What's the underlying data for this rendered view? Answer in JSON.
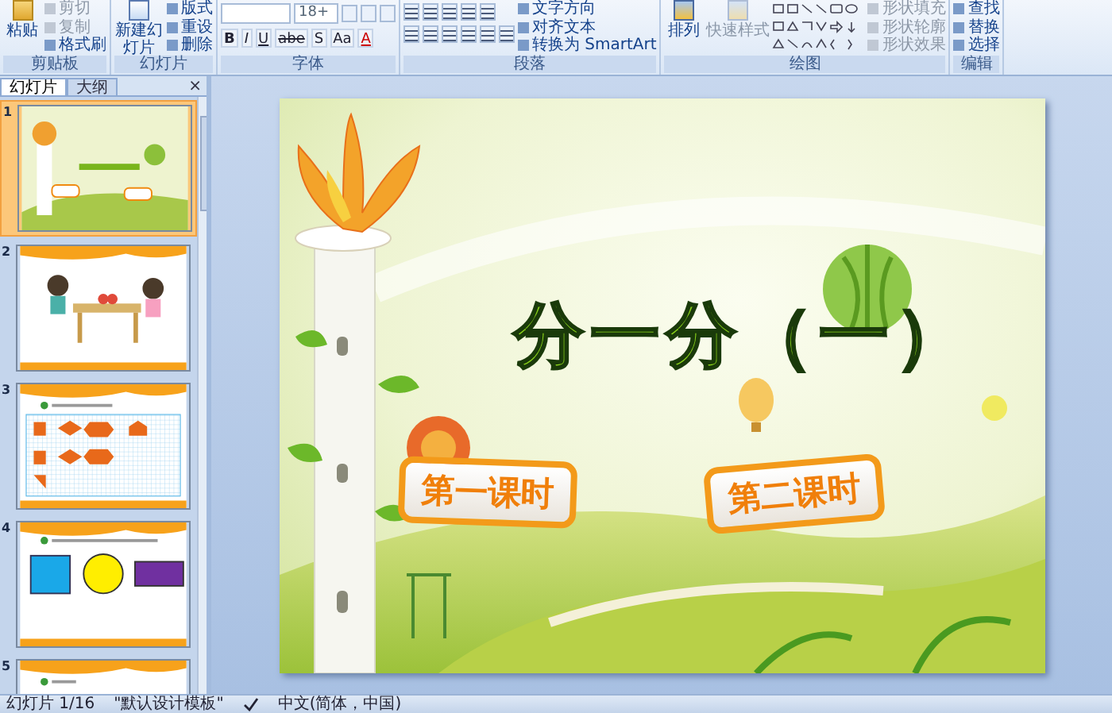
{
  "ribbon": {
    "groups": [
      {
        "kind": "clipboard",
        "label": "剪贴板",
        "large": [
          {
            "label": "粘贴",
            "disabled": false
          }
        ],
        "small": [
          {
            "label": "剪切",
            "disabled": true
          },
          {
            "label": "复制",
            "disabled": true
          },
          {
            "label": "格式刷",
            "disabled": false
          }
        ]
      },
      {
        "kind": "slides",
        "label": "幻灯片",
        "large": [
          {
            "label": "新建幻灯片",
            "disabled": false
          }
        ],
        "small": [
          {
            "label": "版式",
            "disabled": false
          },
          {
            "label": "重设",
            "disabled": false
          },
          {
            "label": "删除",
            "disabled": false
          }
        ]
      },
      {
        "kind": "font",
        "label": "字体",
        "font_size": "18+",
        "format_buttons": [
          "B",
          "I",
          "U",
          "abe",
          "S",
          "Aa",
          "A"
        ]
      },
      {
        "kind": "paragraph",
        "label": "段落",
        "small": [
          {
            "label": "文字方向",
            "disabled": false
          },
          {
            "label": "对齐文本",
            "disabled": false
          },
          {
            "label": "转换为 SmartArt",
            "disabled": false
          }
        ]
      },
      {
        "kind": "drawing",
        "label": "绘图",
        "large": [
          {
            "label": "排列",
            "disabled": false
          },
          {
            "label": "快速样式",
            "disabled": true
          }
        ],
        "small": [
          {
            "label": "形状填充",
            "disabled": true
          },
          {
            "label": "形状轮廓",
            "disabled": true
          },
          {
            "label": "形状效果",
            "disabled": true
          }
        ]
      },
      {
        "kind": "editing",
        "label": "编辑",
        "small": [
          {
            "label": "查找",
            "disabled": false
          },
          {
            "label": "替换",
            "disabled": false
          },
          {
            "label": "选择",
            "disabled": false
          }
        ]
      }
    ]
  },
  "panel": {
    "tabs": [
      {
        "label": "幻灯片",
        "selected": true
      },
      {
        "label": "大纲",
        "selected": false
      }
    ],
    "close": "×",
    "slides": [
      {
        "number": "1",
        "kind": "scenery",
        "selected": true
      },
      {
        "number": "2",
        "kind": "kids",
        "selected": false
      },
      {
        "number": "3",
        "kind": "grid",
        "selected": false
      },
      {
        "number": "4",
        "kind": "shapes",
        "selected": false
      },
      {
        "number": "5",
        "kind": "text",
        "selected": false
      }
    ]
  },
  "slide": {
    "title": "分一分（一）",
    "lessons": [
      "第一课时",
      "第二课时"
    ]
  },
  "status_bar": {
    "slide": "幻灯片 1/16",
    "theme": "\"默认设计模板\"",
    "language": "中文(简体，中国)"
  }
}
